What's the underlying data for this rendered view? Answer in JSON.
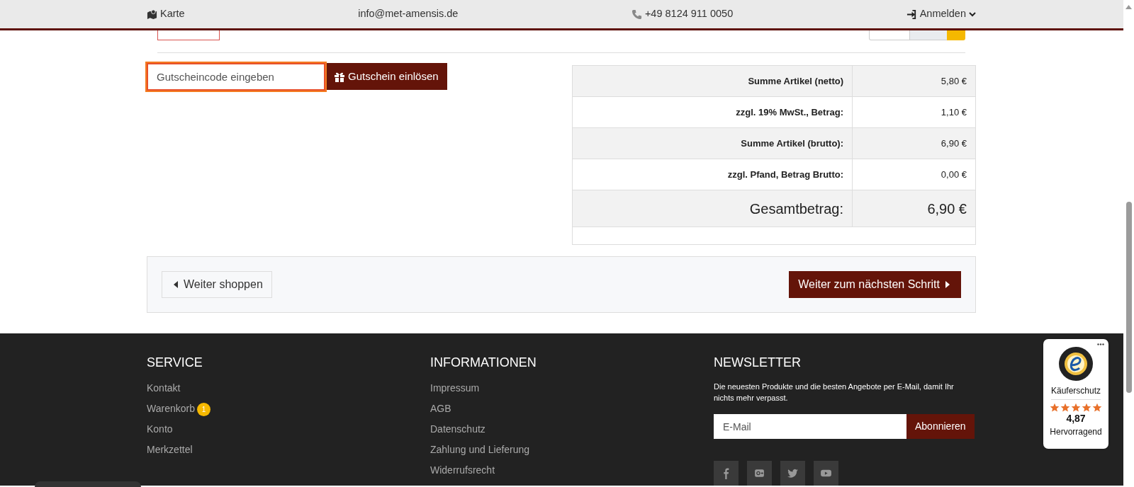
{
  "topbar": {
    "items": [
      {
        "kind": "map",
        "text": "Karte"
      },
      {
        "kind": "email",
        "text": "info@met-amensis.de"
      },
      {
        "kind": "phone",
        "text": "+49 8124 911 0050"
      },
      {
        "kind": "login",
        "text": "Anmelden"
      }
    ]
  },
  "coupon": {
    "placeholder": "Gutscheincode eingeben",
    "button": "Gutschein einlösen"
  },
  "totals": [
    {
      "kind": "normal",
      "label": "Summe Artikel (netto)",
      "value": "5,80 €"
    },
    {
      "kind": "normal",
      "label": "zzgl. 19% MwSt., Betrag:",
      "value": "1,10 €"
    },
    {
      "kind": "normal",
      "label": "Summe Artikel (brutto):",
      "value": "6,90 €"
    },
    {
      "kind": "normal",
      "label": "zzgl. Pfand, Betrag Brutto:",
      "value": "0,00 €"
    },
    {
      "kind": "grand",
      "label": "Gesamtbetrag:",
      "value": "6,90 €"
    }
  ],
  "navigation": {
    "back": "Weiter shoppen",
    "next": "Weiter zum nächsten Schritt"
  },
  "footer": {
    "columns": [
      {
        "title": "SERVICE",
        "links": [
          {
            "label": "Kontakt"
          },
          {
            "label": "Warenkorb",
            "badge": "1"
          },
          {
            "label": "Konto"
          },
          {
            "label": "Merkzettel"
          }
        ]
      },
      {
        "title": "INFORMATIONEN",
        "links": [
          {
            "label": "Impressum"
          },
          {
            "label": "AGB"
          },
          {
            "label": "Datenschutz"
          },
          {
            "label": "Zahlung und Lieferung"
          },
          {
            "label": "Widerrufsrecht"
          }
        ]
      }
    ],
    "newsletter": {
      "title": "NEWSLETTER",
      "text": "Die neuesten Produkte und die besten Angebote per E-Mail, damit Ihr nichts mehr verpasst.",
      "placeholder": "E-Mail",
      "button": "Abonnieren"
    },
    "social": [
      {
        "kind": "facebook"
      },
      {
        "kind": "googleplus"
      },
      {
        "kind": "twitter"
      },
      {
        "kind": "youtube"
      }
    ]
  },
  "trust_badge": {
    "label": "Käuferschutz",
    "stars": 5,
    "rating": "4,87",
    "verdict": "Hervorragend"
  }
}
